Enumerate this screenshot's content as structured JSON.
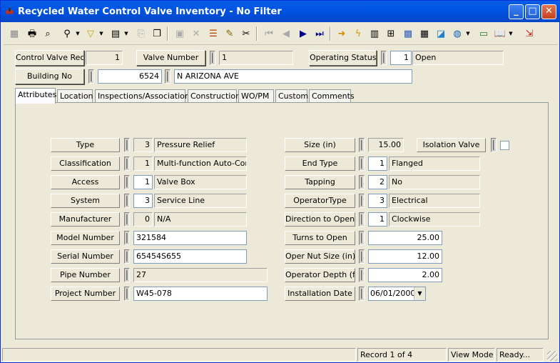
{
  "window": {
    "title": "Recycled Water Control Valve Inventory - No Filter"
  },
  "colors": {
    "titlebar": "#0054e3",
    "face": "#ece9d8",
    "input_bg": "#ffffff"
  },
  "toolbar": {
    "icons": [
      "table-icon",
      "print-icon",
      "print-preview-icon",
      "search-binoculars-icon",
      "filter-icon",
      "report-icon",
      "copy-disabled-icon",
      "clone-icon",
      "save-disabled-icon",
      "delete-disabled-icon",
      "stack-icon",
      "edit-pencil-icon",
      "cut-icon",
      "first-record-icon",
      "previous-record-icon",
      "next-record-icon",
      "last-record-icon",
      "new-record-arrow-icon",
      "lightning-icon",
      "browse-icon",
      "hierarchy-icon",
      "map-icon",
      "calculator-icon",
      "view-icon",
      "globe-icon",
      "keyboard-icon",
      "book-icon",
      "exit-icon"
    ]
  },
  "header": {
    "rec_label": "Control Valve Rec #",
    "rec_value": "1",
    "valve_label": "Valve Number",
    "valve_value": "1",
    "status_label": "Operating Status",
    "status_code": "1",
    "status_value": "Open",
    "building_label": "Building No",
    "building_code": "6524",
    "building_value": "N ARIZONA AVE"
  },
  "tabs": [
    "Attributes",
    "Location",
    "Inspections/Associations",
    "Construction",
    "WO/PM",
    "Custom",
    "Comments"
  ],
  "left_fields": [
    {
      "label": "Type",
      "code": "3",
      "value": "Pressure Relief"
    },
    {
      "label": "Classification",
      "code": "1",
      "value": "Multi-function Auto-Contr"
    },
    {
      "label": "Access",
      "code": "1",
      "value": "Valve Box"
    },
    {
      "label": "System",
      "code": "3",
      "value": "Service Line"
    },
    {
      "label": "Manufacturer",
      "code": "0",
      "value": "N/A"
    },
    {
      "label": "Model Number",
      "value": "321584"
    },
    {
      "label": "Serial Number",
      "value": "65454S655"
    },
    {
      "label": "Pipe Number",
      "value": "27"
    },
    {
      "label": "Project Number",
      "value": "W45-078"
    }
  ],
  "right_fields": [
    {
      "label": "Size (in)",
      "value": "15.00"
    },
    {
      "label": "End Type",
      "code": "1",
      "value": "Flanged"
    },
    {
      "label": "Tapping",
      "code": "2",
      "value": "No"
    },
    {
      "label": "OperatorType",
      "code": "3",
      "value": "Electrical"
    },
    {
      "label": "Direction to Open",
      "code": "1",
      "value": "Clockwise"
    },
    {
      "label": "Turns to Open",
      "value": "25.00"
    },
    {
      "label": "Oper Nut Size (in)",
      "value": "12.00"
    },
    {
      "label": "Operator Depth (ft)",
      "value": "2.00"
    },
    {
      "label": "Installation Date",
      "value": "06/01/2000"
    }
  ],
  "isolation": {
    "label": "Isolation Valve",
    "checked": false
  },
  "statusbar": {
    "record": "Record 1 of 4",
    "mode": "View Mode",
    "state": "Ready..."
  }
}
